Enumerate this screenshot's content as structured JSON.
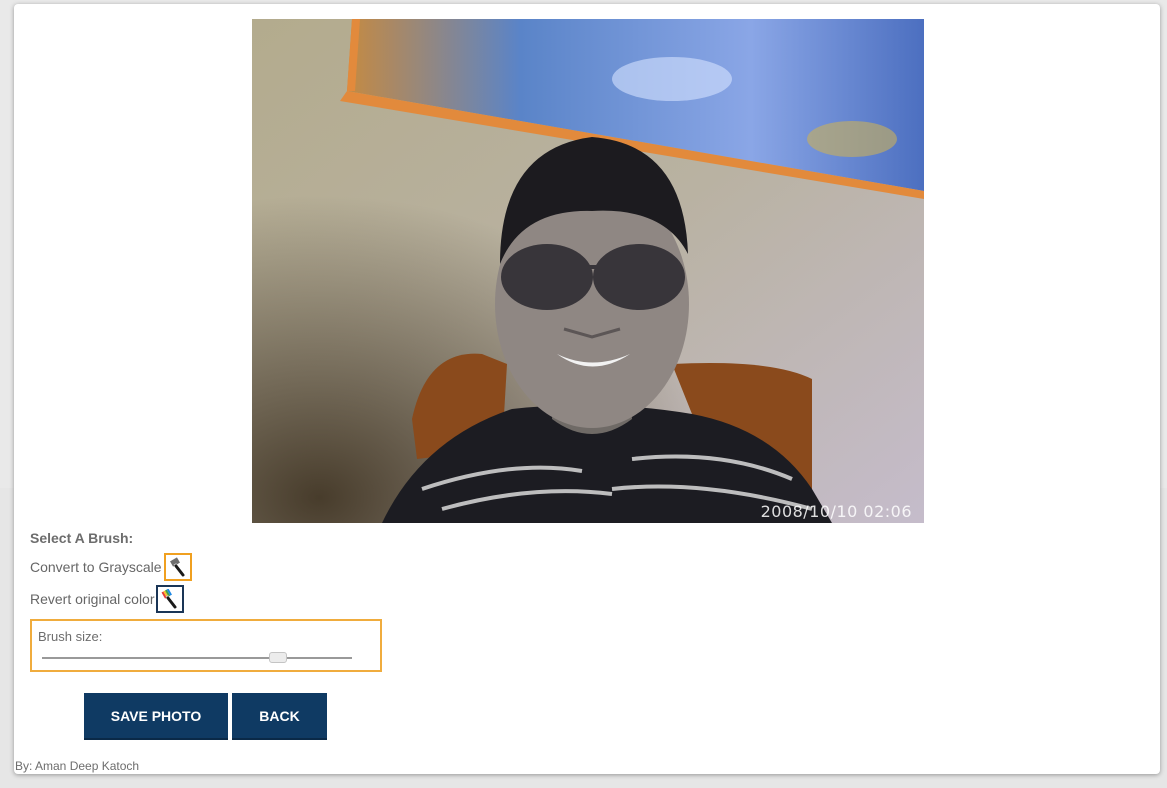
{
  "photo": {
    "stamp": "2008/10/10 02:06"
  },
  "tools": {
    "heading": "Select A Brush:",
    "grayscale_label": "Convert to Grayscale",
    "revert_label": "Revert original color",
    "brush_size_label": "Brush size:",
    "brush_size_fraction": 0.76
  },
  "actions": {
    "save_label": "SAVE PHOTO",
    "back_label": "BACK"
  },
  "footer": {
    "credit": "By: Aman Deep Katoch"
  },
  "colors": {
    "accent": "#f0a020",
    "button": "#0f3a63",
    "selected_border": "#1a3556"
  },
  "icons": {
    "grayscale_tool": "gray-paintbrush-icon",
    "revert_tool": "rainbow-paintbrush-icon"
  }
}
